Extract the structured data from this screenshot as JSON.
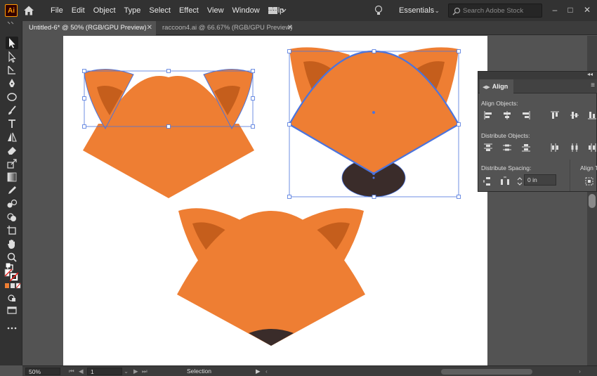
{
  "app": {
    "logo_text": "Ai"
  },
  "menu": {
    "items": [
      "File",
      "Edit",
      "Object",
      "Type",
      "Select",
      "Effect",
      "View",
      "Window",
      "Help"
    ]
  },
  "header": {
    "workspace": "Essentials",
    "search_placeholder": "Search Adobe Stock"
  },
  "tabs": [
    {
      "label": "Untitled-6* @ 50% (RGB/GPU Preview)",
      "active": true
    },
    {
      "label": "raccoon4.ai @ 66.67% (RGB/GPU Preview)",
      "active": false
    }
  ],
  "align_panel": {
    "tab_label": "Align",
    "align_objects_label": "Align Objects:",
    "distribute_objects_label": "Distribute Objects:",
    "distribute_spacing_label": "Distribute Spacing:",
    "align_to_label": "Align T",
    "spacing_value": "0 in"
  },
  "status": {
    "zoom": "50%",
    "artboard": "1",
    "tool_name": "Selection"
  },
  "colors": {
    "fox_orange": "#EE7E33",
    "ear_inner": "#C55E1C",
    "nose": "#3A2C2A",
    "selection_blue": "#4B74DD",
    "ai_orange": "#FF9A00"
  }
}
